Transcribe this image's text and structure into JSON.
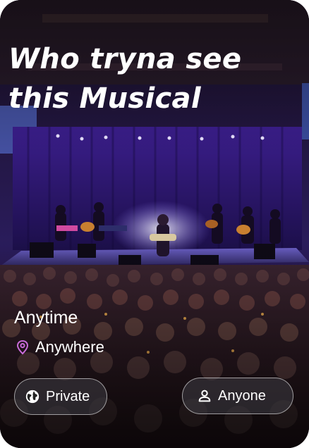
{
  "event_card": {
    "title": "Who tryna see this Musical",
    "when_label": "Anytime",
    "where_label": "Anywhere",
    "privacy_chip": {
      "label": "Private",
      "icon": "globe-icon"
    },
    "audience_chip": {
      "label": "Anyone",
      "icon": "person-icon"
    },
    "location_icon": "map-pin-icon",
    "colors": {
      "text": "#ffffff",
      "pin_accent": "#c86bd8",
      "stage_purple": "#5a2fa8",
      "chip_border": "#ffffff"
    }
  }
}
